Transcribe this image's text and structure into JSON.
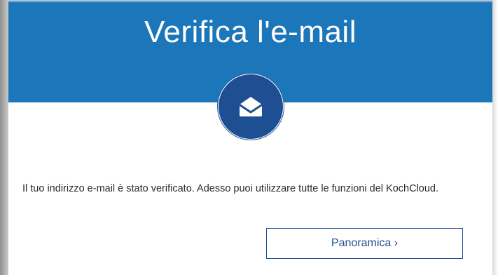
{
  "page": {
    "title": "Verifica l'e-mail",
    "message": "Il tuo indirizzo e-mail è stato verificato. Adesso puoi utilizzare tutte le funzioni del KochCloud.",
    "button_label": "Panoramica ›"
  },
  "icons": {
    "badge": "open-envelope-icon"
  },
  "colors": {
    "header_blue": "#1b76ba",
    "badge_blue": "#1f4f93",
    "button_border": "#1f4f93",
    "text": "#2b2b2b"
  }
}
